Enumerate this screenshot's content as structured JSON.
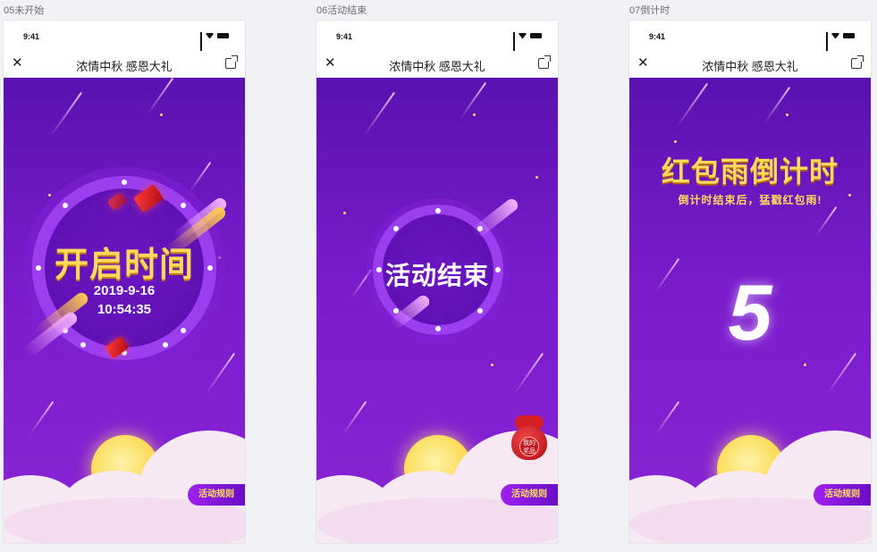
{
  "boards": [
    {
      "label": "05未开始"
    },
    {
      "label": "06活动结束"
    },
    {
      "label": "07倒计时"
    }
  ],
  "status_bar": {
    "time": "9:41"
  },
  "navbar": {
    "close_icon": "close-icon",
    "title": "浓情中秋  感恩大礼",
    "share_icon": "share-icon"
  },
  "screen_not_started": {
    "title": "开启时间",
    "date": "2019-9-16",
    "time": "10:54:35"
  },
  "screen_ended": {
    "title": "活动结束",
    "bag_label": "我的\n奖品"
  },
  "screen_countdown": {
    "title": "红包雨倒计时",
    "subtitle": "倒计时结束后，猛戳红包雨!",
    "count": "5"
  },
  "rules_button": "活动规则",
  "colors": {
    "bg_top": "#5a12b0",
    "bg_bottom": "#8a24d5",
    "gold": "#ffd95a",
    "ring": "#9b3ef0"
  }
}
